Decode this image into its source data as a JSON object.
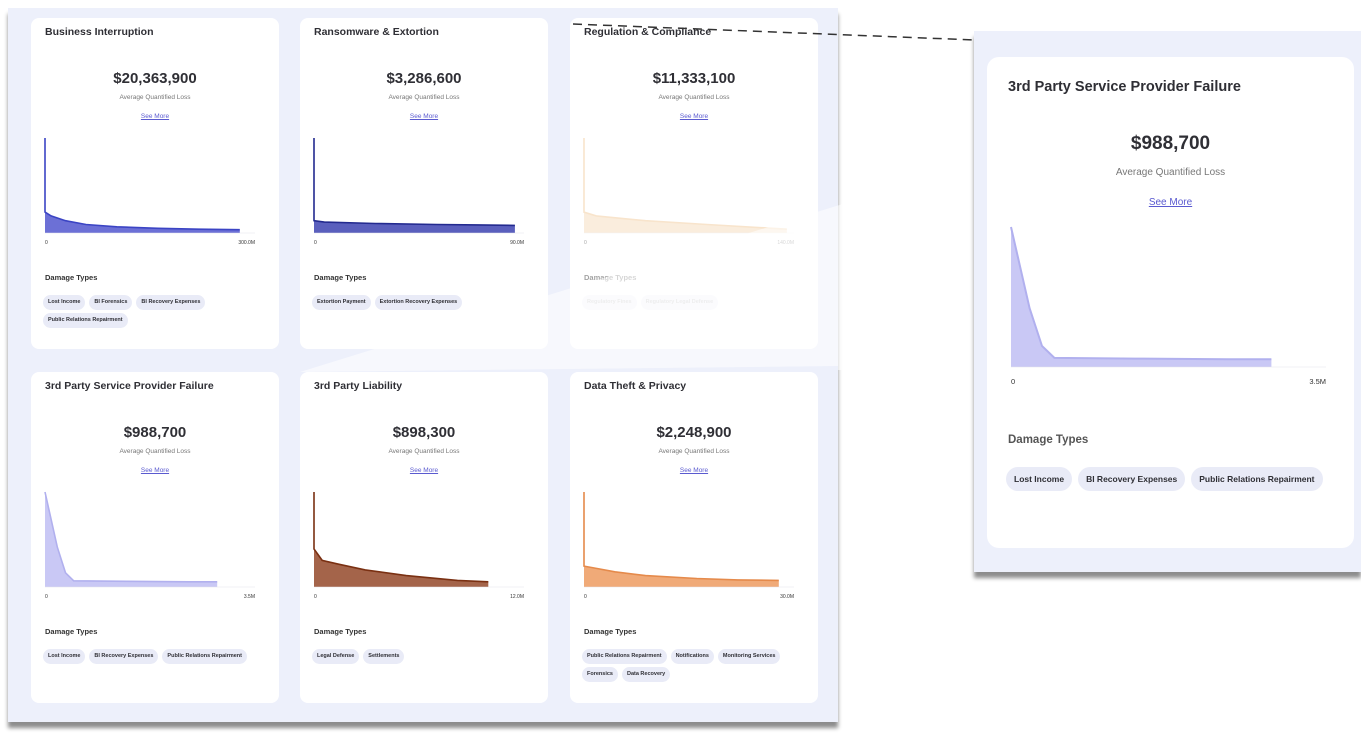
{
  "cards": [
    {
      "title": "Business Interruption",
      "amount": "$20,363,900",
      "subtitle": "Average Quantified Loss",
      "link": "See More",
      "damage_label": "Damage Types",
      "tags": [
        "Lost Income",
        "BI Forensics",
        "BI Recovery Expenses",
        "Public Relations Repairment"
      ],
      "color": "#3b44c4",
      "fill": "#6c70d6",
      "x_labels": [
        "0",
        "300.0M"
      ]
    },
    {
      "title": "Ransomware & Extortion",
      "amount": "$3,286,600",
      "subtitle": "Average Quantified Loss",
      "link": "See More",
      "damage_label": "Damage Types",
      "tags": [
        "Extortion Payment",
        "Extortion Recovery Expenses"
      ],
      "color": "#232a8f",
      "fill": "#5a5fbd",
      "x_labels": [
        "0",
        "90.0M"
      ]
    },
    {
      "title": "Regulation & Compliance",
      "amount": "$11,333,100",
      "subtitle": "Average Quantified Loss",
      "link": "See More",
      "damage_label": "Damage Types",
      "tags": [
        "Regulatory Fines",
        "Regulatory Legal Defense"
      ],
      "color": "#f0c48f",
      "fill": "#f6d9b5",
      "x_labels": [
        "0",
        "140.0M"
      ]
    },
    {
      "title": "3rd Party Service Provider Failure",
      "amount": "$988,700",
      "subtitle": "Average Quantified Loss",
      "link": "See More",
      "damage_label": "Damage Types",
      "tags": [
        "Lost Income",
        "BI Recovery Expenses",
        "Public Relations Repairment"
      ],
      "color": "#b1b0ee",
      "fill": "#c9c8f5",
      "x_labels": [
        "0",
        "3.5M"
      ]
    },
    {
      "title": "3rd Party Liability",
      "amount": "$898,300",
      "subtitle": "Average Quantified Loss",
      "link": "See More",
      "damage_label": "Damage Types",
      "tags": [
        "Legal Defense",
        "Settlements"
      ],
      "color": "#7a3012",
      "fill": "#a4644a",
      "x_labels": [
        "0",
        "12.0M"
      ]
    },
    {
      "title": "Data Theft & Privacy",
      "amount": "$2,248,900",
      "subtitle": "Average Quantified Loss",
      "link": "See More",
      "damage_label": "Damage Types",
      "tags": [
        "Public Relations Repairment",
        "Notifications",
        "Monitoring Services",
        "Forensics",
        "Data Recovery"
      ],
      "color": "#e58a4b",
      "fill": "#f0aa78",
      "x_labels": [
        "0",
        "30.0M"
      ]
    }
  ],
  "zoom": {
    "title": "3rd Party Service Provider Failure",
    "amount": "$988,700",
    "subtitle": "Average Quantified Loss",
    "link": "See More",
    "damage_label": "Damage Types",
    "tags": [
      "Lost Income",
      "BI Recovery Expenses",
      "Public Relations Repairment"
    ],
    "color": "#b1b0ee",
    "fill": "#c9c8f5",
    "x_labels": [
      "0",
      "3.5M"
    ]
  }
}
